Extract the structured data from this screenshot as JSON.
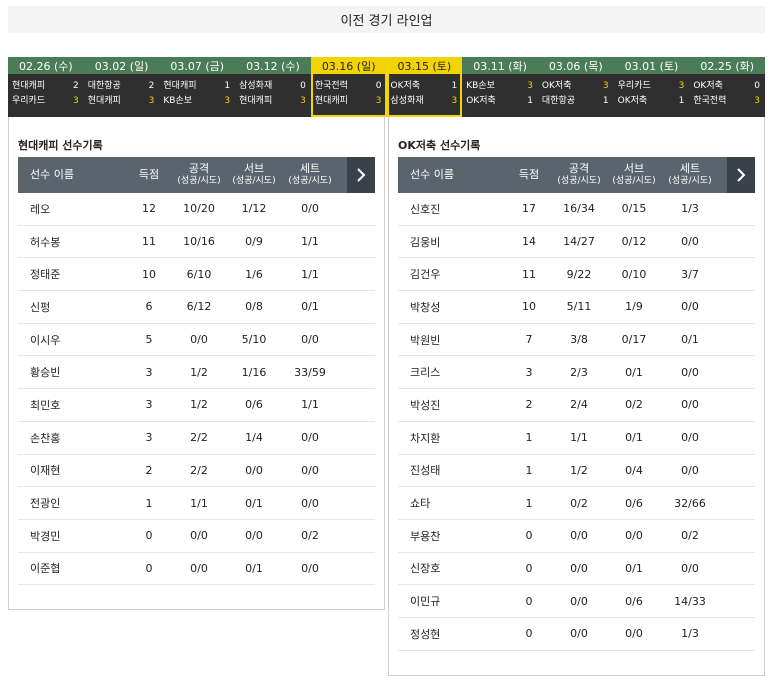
{
  "page_title": "이전 경기 라인업",
  "matches": [
    {
      "date": "02.26 (수)",
      "home": "현대캐피",
      "home_score": "2",
      "away": "우리카드",
      "away_score": "3",
      "winner": "away",
      "selected": false
    },
    {
      "date": "03.02 (일)",
      "home": "대한항공",
      "home_score": "2",
      "away": "현대캐피",
      "away_score": "3",
      "winner": "away",
      "selected": false
    },
    {
      "date": "03.07 (금)",
      "home": "현대캐피",
      "home_score": "1",
      "away": "KB손보",
      "away_score": "3",
      "winner": "away",
      "selected": false
    },
    {
      "date": "03.12 (수)",
      "home": "삼성화재",
      "home_score": "0",
      "away": "현대캐피",
      "away_score": "3",
      "winner": "away",
      "selected": false
    },
    {
      "date": "03.16 (일)",
      "home": "한국전력",
      "home_score": "0",
      "away": "현대캐피",
      "away_score": "3",
      "winner": "away",
      "selected": true
    },
    {
      "date": "03.15 (토)",
      "home": "OK저축",
      "home_score": "1",
      "away": "삼성화재",
      "away_score": "3",
      "winner": "away",
      "selected": true
    },
    {
      "date": "03.11 (화)",
      "home": "KB손보",
      "home_score": "3",
      "away": "OK저축",
      "away_score": "1",
      "winner": "home",
      "selected": false
    },
    {
      "date": "03.06 (목)",
      "home": "OK저축",
      "home_score": "3",
      "away": "대한항공",
      "away_score": "1",
      "winner": "home",
      "selected": false
    },
    {
      "date": "03.01 (토)",
      "home": "우리카드",
      "home_score": "3",
      "away": "OK저축",
      "away_score": "1",
      "winner": "home",
      "selected": false
    },
    {
      "date": "02.25 (화)",
      "home": "OK저축",
      "home_score": "0",
      "away": "한국전력",
      "away_score": "3",
      "winner": "away",
      "selected": false
    }
  ],
  "columns": {
    "name": "선수 이름",
    "points": "득점",
    "attack": "공격",
    "attack_sub": "(성공/시도)",
    "serve": "서브",
    "serve_sub": "(성공/시도)",
    "set": "세트",
    "set_sub": "(성공/시도)",
    "next_icon": "chevron-right-icon"
  },
  "left": {
    "title": "현대캐피 선수기록",
    "players": [
      {
        "name": "레오",
        "points": "12",
        "attack": "10/20",
        "serve": "1/12",
        "set": "0/0"
      },
      {
        "name": "허수봉",
        "points": "11",
        "attack": "10/16",
        "serve": "0/9",
        "set": "1/1"
      },
      {
        "name": "정태준",
        "points": "10",
        "attack": "6/10",
        "serve": "1/6",
        "set": "1/1"
      },
      {
        "name": "신펑",
        "points": "6",
        "attack": "6/12",
        "serve": "0/8",
        "set": "0/1"
      },
      {
        "name": "이시우",
        "points": "5",
        "attack": "0/0",
        "serve": "5/10",
        "set": "0/0"
      },
      {
        "name": "황승빈",
        "points": "3",
        "attack": "1/2",
        "serve": "1/16",
        "set": "33/59"
      },
      {
        "name": "최민호",
        "points": "3",
        "attack": "1/2",
        "serve": "0/6",
        "set": "1/1"
      },
      {
        "name": "손찬홍",
        "points": "3",
        "attack": "2/2",
        "serve": "1/4",
        "set": "0/0"
      },
      {
        "name": "이재현",
        "points": "2",
        "attack": "2/2",
        "serve": "0/0",
        "set": "0/0"
      },
      {
        "name": "전광인",
        "points": "1",
        "attack": "1/1",
        "serve": "0/1",
        "set": "0/0"
      },
      {
        "name": "박경민",
        "points": "0",
        "attack": "0/0",
        "serve": "0/0",
        "set": "0/2"
      },
      {
        "name": "이준협",
        "points": "0",
        "attack": "0/0",
        "serve": "0/1",
        "set": "0/0"
      }
    ]
  },
  "right": {
    "title": "OK저축 선수기록",
    "players": [
      {
        "name": "신호진",
        "points": "17",
        "attack": "16/34",
        "serve": "0/15",
        "set": "1/3"
      },
      {
        "name": "김웅비",
        "points": "14",
        "attack": "14/27",
        "serve": "0/12",
        "set": "0/0"
      },
      {
        "name": "김건우",
        "points": "11",
        "attack": "9/22",
        "serve": "0/10",
        "set": "3/7"
      },
      {
        "name": "박창성",
        "points": "10",
        "attack": "5/11",
        "serve": "1/9",
        "set": "0/0"
      },
      {
        "name": "박원빈",
        "points": "7",
        "attack": "3/8",
        "serve": "0/17",
        "set": "0/1"
      },
      {
        "name": "크리스",
        "points": "3",
        "attack": "2/3",
        "serve": "0/1",
        "set": "0/0"
      },
      {
        "name": "박성진",
        "points": "2",
        "attack": "2/4",
        "serve": "0/2",
        "set": "0/0"
      },
      {
        "name": "차지환",
        "points": "1",
        "attack": "1/1",
        "serve": "0/1",
        "set": "0/0"
      },
      {
        "name": "진성태",
        "points": "1",
        "attack": "1/2",
        "serve": "0/4",
        "set": "0/0"
      },
      {
        "name": "쇼타",
        "points": "1",
        "attack": "0/2",
        "serve": "0/6",
        "set": "32/66"
      },
      {
        "name": "부용찬",
        "points": "0",
        "attack": "0/0",
        "serve": "0/0",
        "set": "0/2"
      },
      {
        "name": "신장호",
        "points": "0",
        "attack": "0/0",
        "serve": "0/1",
        "set": "0/0"
      },
      {
        "name": "이민규",
        "points": "0",
        "attack": "0/0",
        "serve": "0/6",
        "set": "14/33"
      },
      {
        "name": "정성현",
        "points": "0",
        "attack": "0/0",
        "serve": "0/0",
        "set": "1/3"
      }
    ]
  }
}
